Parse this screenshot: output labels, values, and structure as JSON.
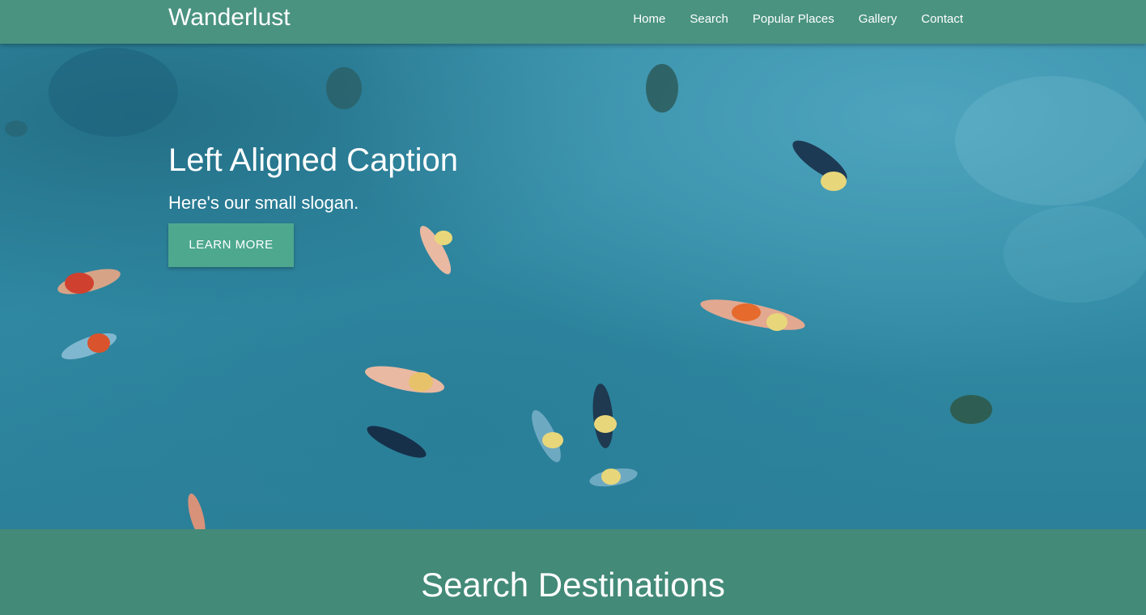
{
  "brand": "Wanderlust",
  "nav": {
    "items": [
      {
        "label": "Home"
      },
      {
        "label": "Search"
      },
      {
        "label": "Popular Places"
      },
      {
        "label": "Gallery"
      },
      {
        "label": "Contact"
      }
    ]
  },
  "hero": {
    "title": "Left Aligned Caption",
    "slogan": "Here's our small slogan.",
    "button_label": "LEARN MORE"
  },
  "search_section": {
    "title": "Search Destinations"
  },
  "colors": {
    "navbar": "#4a9381",
    "section_bg": "#438a78",
    "button": "#4da88e",
    "water": "#338ba4"
  }
}
